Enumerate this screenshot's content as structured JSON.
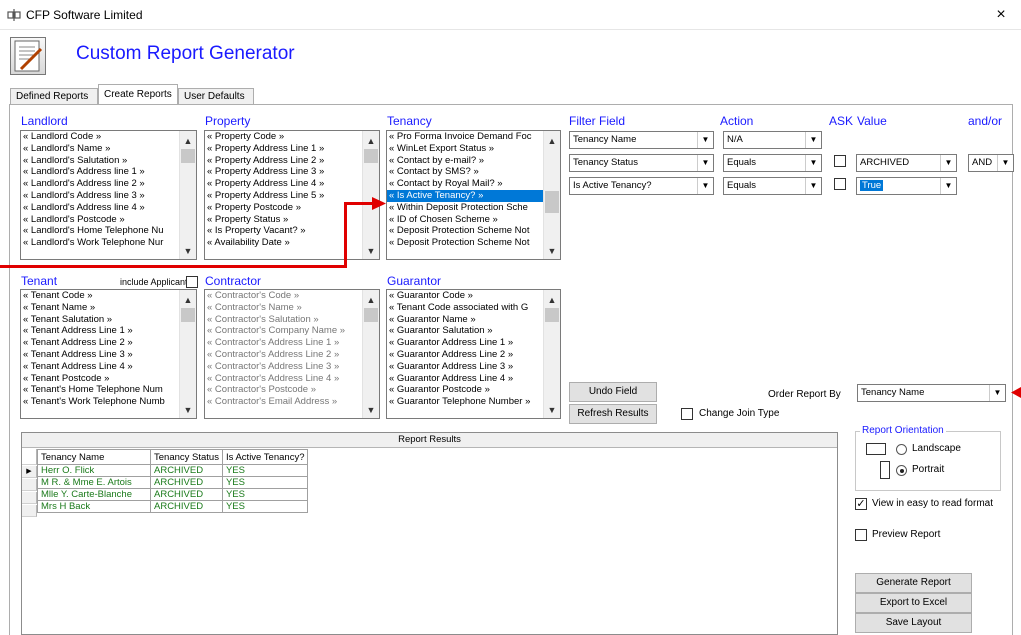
{
  "window": {
    "title": "CFP Software Limited",
    "close": "×"
  },
  "app": {
    "title": "Custom Report Generator"
  },
  "tabs": [
    "Defined Reports",
    "Create Reports",
    "User Defaults"
  ],
  "landlord": {
    "title": "Landlord",
    "items": [
      "« Landlord Code »",
      "« Landlord's Name »",
      "« Landlord's Salutation »",
      "« Landlord's Address line 1 »",
      "« Landlord's Address line 2 »",
      "« Landlord's Address line 3 »",
      "« Landlord's Address line 4 »",
      "« Landlord's Postcode »",
      "« Landlord's Home Telephone Nu",
      "« Landlord's Work Telephone Nur"
    ]
  },
  "property": {
    "title": "Property",
    "items": [
      "« Property Code »",
      "« Property Address Line 1 »",
      "« Property Address Line 2 »",
      "« Property Address Line 3 »",
      "« Property Address Line 4 »",
      "« Property Address Line 5 »",
      "« Property Postcode »",
      "« Property Status »",
      "« Is Property Vacant? »",
      "« Availability Date »"
    ]
  },
  "tenancy": {
    "title": "Tenancy",
    "items": [
      "« Pro Forma Invoice Demand Foc",
      "« WinLet Export Status »",
      "« Contact by e-mail? »",
      "« Contact by SMS? »",
      "« Contact by Royal Mail? »",
      "« Is Active Tenancy? »",
      "« Within Deposit Protection Sche",
      "« ID of Chosen Scheme »",
      "« Deposit Protection Scheme Not",
      "« Deposit Protection Scheme Not"
    ]
  },
  "tenant": {
    "title": "Tenant",
    "include_label": "include Applicants",
    "items": [
      "« Tenant Code »",
      "« Tenant Name »",
      "« Tenant Salutation »",
      "« Tenant Address Line 1 »",
      "« Tenant Address Line 2 »",
      "« Tenant Address Line 3 »",
      "« Tenant Address Line 4 »",
      "« Tenant Postcode »",
      "« Tenant's Home Telephone Num",
      "« Tenant's Work Telephone Numb"
    ]
  },
  "contractor": {
    "title": "Contractor",
    "items": [
      "« Contractor's Code »",
      "« Contractor's Name »",
      "« Contractor's Salutation »",
      "« Contractor's Company Name »",
      "« Contractor's Address Line 1 »",
      "« Contractor's Address Line 2 »",
      "« Contractor's Address Line 3 »",
      "« Contractor's Address Line 4 »",
      "« Contractor's Postcode »",
      "« Contractor's Email Address »"
    ]
  },
  "guarantor": {
    "title": "Guarantor",
    "items": [
      "« Guarantor Code »",
      "« Tenant Code associated with G",
      "« Guarantor Name »",
      "« Guarantor Salutation »",
      "« Guarantor Address Line 1 »",
      "« Guarantor Address Line 2 »",
      "« Guarantor Address Line 3 »",
      "« Guarantor Address Line 4 »",
      "« Guarantor Postcode »",
      "« Guarantor Telephone Number »"
    ]
  },
  "filters": {
    "headers": {
      "field": "Filter Field",
      "action": "Action",
      "ask": "ASK",
      "value": "Value",
      "andor": "and/or"
    },
    "rows": [
      {
        "field": "Tenancy Name",
        "action": "N/A",
        "value": "",
        "andor": ""
      },
      {
        "field": "Tenancy Status",
        "action": "Equals",
        "value": "ARCHIVED",
        "andor": "AND"
      },
      {
        "field": "Is Active Tenancy?",
        "action": "Equals",
        "value": "True",
        "andor": ""
      }
    ]
  },
  "buttons": {
    "undo": "Undo Field",
    "refresh": "Refresh Results",
    "generate": "Generate Report",
    "export": "Export to Excel",
    "save": "Save Layout"
  },
  "change_join": "Change Join Type",
  "order": {
    "label": "Order Report By",
    "value": "Tenancy Name"
  },
  "results": {
    "caption": "Report Results",
    "columns": [
      "Tenancy Name",
      "Tenancy Status",
      "Is Active Tenancy?"
    ],
    "rows": [
      [
        "Herr O. Flick",
        "ARCHIVED",
        "YES"
      ],
      [
        "M R. & Mme E. Artois",
        "ARCHIVED",
        "YES"
      ],
      [
        "Mlle Y. Carte-Blanche",
        "ARCHIVED",
        "YES"
      ],
      [
        "Mrs H Back",
        "ARCHIVED",
        "YES"
      ]
    ]
  },
  "orientation": {
    "legend": "Report Orientation",
    "landscape": "Landscape",
    "portrait": "Portrait"
  },
  "options": {
    "easy_read": "View in easy to read format",
    "preview": "Preview Report"
  },
  "colors": {
    "accent": "#1a1aff",
    "selection": "#0078d7",
    "result_text": "#1a7a1a",
    "annotation_arrow": "#e00000"
  }
}
